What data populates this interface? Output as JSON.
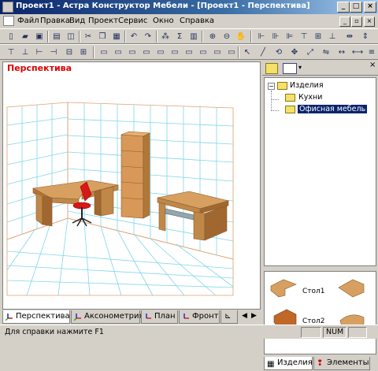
{
  "window": {
    "title": "Проект1 - Астра Конструктор Мебели - [Проект1 - Перспектива]"
  },
  "menu": [
    "Файл",
    "Правка",
    "Вид",
    "Проект",
    "Сервис",
    "Окно",
    "Справка"
  ],
  "viewport": {
    "title": "Перспектива"
  },
  "tabs": [
    "Перспектива",
    "Аксонометрия",
    "План",
    "Фронт"
  ],
  "tree": {
    "root": "Изделия",
    "children": [
      "Кухни",
      "Офисная мебель"
    ]
  },
  "thumbs": [
    "Стол1",
    "Стол2"
  ],
  "panel_tabs": [
    "Изделия",
    "Элементы"
  ],
  "status": {
    "help": "Для справки нажмите F1",
    "num": "NUM"
  }
}
